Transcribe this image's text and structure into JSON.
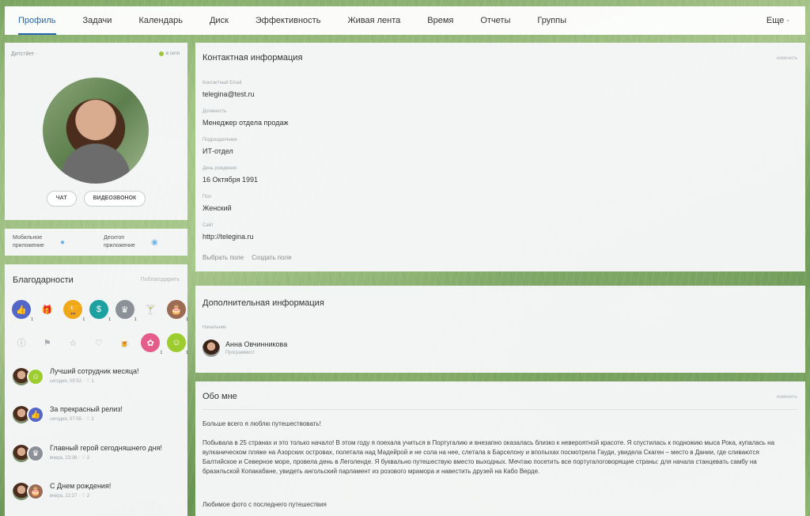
{
  "nav": {
    "items": [
      "Профиль",
      "Задачи",
      "Календарь",
      "Диск",
      "Эффективность",
      "Живая лента",
      "Время",
      "Отчеты",
      "Группы"
    ],
    "more": "Еще ·"
  },
  "profile": {
    "status_left": "Дитстйет ·",
    "status_right": "в сети",
    "status_color": "#9bc53d",
    "chat": "ЧАТ",
    "video": "ВИДЕОЗВОНОК"
  },
  "apps": {
    "mobile": [
      "Мобильное",
      "приложение"
    ],
    "desktop": [
      "Десктоп",
      "приложение"
    ],
    "mobile_icon": "apple-icon",
    "desktop_icon": "desktop-icon"
  },
  "thanks": {
    "title": "Благодарности",
    "link": "Поблагодарить",
    "row1": [
      {
        "icon": "thumbs-up-icon",
        "glyph": "👍",
        "cls": "b-blue",
        "count": "1"
      },
      {
        "icon": "gift-icon",
        "glyph": "🎁",
        "cls": "out",
        "count": ""
      },
      {
        "icon": "cup-icon",
        "glyph": "🏆",
        "cls": "b-orange",
        "count": "1"
      },
      {
        "icon": "money-bag-icon",
        "glyph": "$",
        "cls": "b-teal",
        "count": "1"
      },
      {
        "icon": "crown-icon",
        "glyph": "♛",
        "cls": "b-grey",
        "count": "1"
      },
      {
        "icon": "cocktail-icon",
        "glyph": "🍸",
        "cls": "out",
        "count": ""
      },
      {
        "icon": "cake-icon",
        "glyph": "🎂",
        "cls": "b-brown",
        "count": "1"
      }
    ],
    "row2": [
      {
        "icon": "info-icon",
        "glyph": "ⓘ",
        "cls": "out",
        "count": ""
      },
      {
        "icon": "flag-icon",
        "glyph": "⚑",
        "cls": "out",
        "count": ""
      },
      {
        "icon": "star-icon",
        "glyph": "☆",
        "cls": "out",
        "count": ""
      },
      {
        "icon": "heart-icon",
        "glyph": "♡",
        "cls": "out",
        "count": ""
      },
      {
        "icon": "beer-icon",
        "glyph": "🍺",
        "cls": "out",
        "count": ""
      },
      {
        "icon": "flower-icon",
        "glyph": "✿",
        "cls": "b-pink",
        "count": "1"
      },
      {
        "icon": "smile-icon",
        "glyph": "☺",
        "cls": "b-lime",
        "count": "1"
      }
    ],
    "feed": [
      {
        "title": "Лучший сотрудник месяца!",
        "meta": "сегодня, 09:52  ·  ♡ 1",
        "icon": "smile-icon",
        "glyph": "☺",
        "color": "#9ccc2e"
      },
      {
        "title": "За прекрасный релиз!",
        "meta": "сегодня, 07:55  ·  ♡ 2",
        "icon": "thumbs-up-icon",
        "glyph": "👍",
        "color": "#5366c9"
      },
      {
        "title": "Главный герой сегодняшнего дня!",
        "meta": "вчера, 23:38  ·  ♡ 2",
        "icon": "crown-icon",
        "glyph": "♛",
        "color": "#8c9197"
      },
      {
        "title": "С Днем рождения!",
        "meta": "вчера, 22:27  ·  ♡ 2",
        "icon": "cake-icon",
        "glyph": "🎂",
        "color": "#9b6b53"
      }
    ]
  },
  "contact": {
    "title": "Контактная информация",
    "edit": "изменить",
    "fields": [
      {
        "label": "Контактный Email",
        "value": "telegina@test.ru"
      },
      {
        "label": "Должность",
        "value": "Менеджер отдела продаж"
      },
      {
        "label": "Подразделение",
        "value": "ИТ-отдел"
      },
      {
        "label": "День рождения",
        "value": "16 Октября 1991"
      },
      {
        "label": "Пол",
        "value": "Женский"
      },
      {
        "label": "Сайт",
        "value": "http://telegina.ru"
      }
    ],
    "choose_field": "Выбрать поле",
    "create_field": "Создать поле"
  },
  "extra": {
    "title": "Дополнительная информация",
    "manager_label": "Начальник",
    "manager_name": "Анна Овчинникова",
    "manager_role": "Программист"
  },
  "about": {
    "title": "Обо мне",
    "edit": "изменить",
    "p1": "Больше всего я люблю путешествовать!",
    "p2": "Побывала в 25 странах и это только начало! В этом году я поехала учиться в Португалию и внезапно оказалась близко к невероятной красоте. Я спустилась к подножию мыса Рока, купалась на вулканическом пляже на Азорских островах, полетала над Мадейрой и не сола на нее, слетала в Барселону и впопыхах посмотрела Гауди, увидела Скаген – место в Дании, где сливаются Балтийское и Северное море, провела день в Леголенде. Я буквально путешествую вместо выходных. Мечтаю посетить все португалоговорящие страны: для начала станцевать самбу на бразильской Копакабане, увидеть ангольский парламент из розового мрамора и навестить друзей на Кабо Верде.",
    "p3": "Любимое фото с последнего путешествия"
  }
}
